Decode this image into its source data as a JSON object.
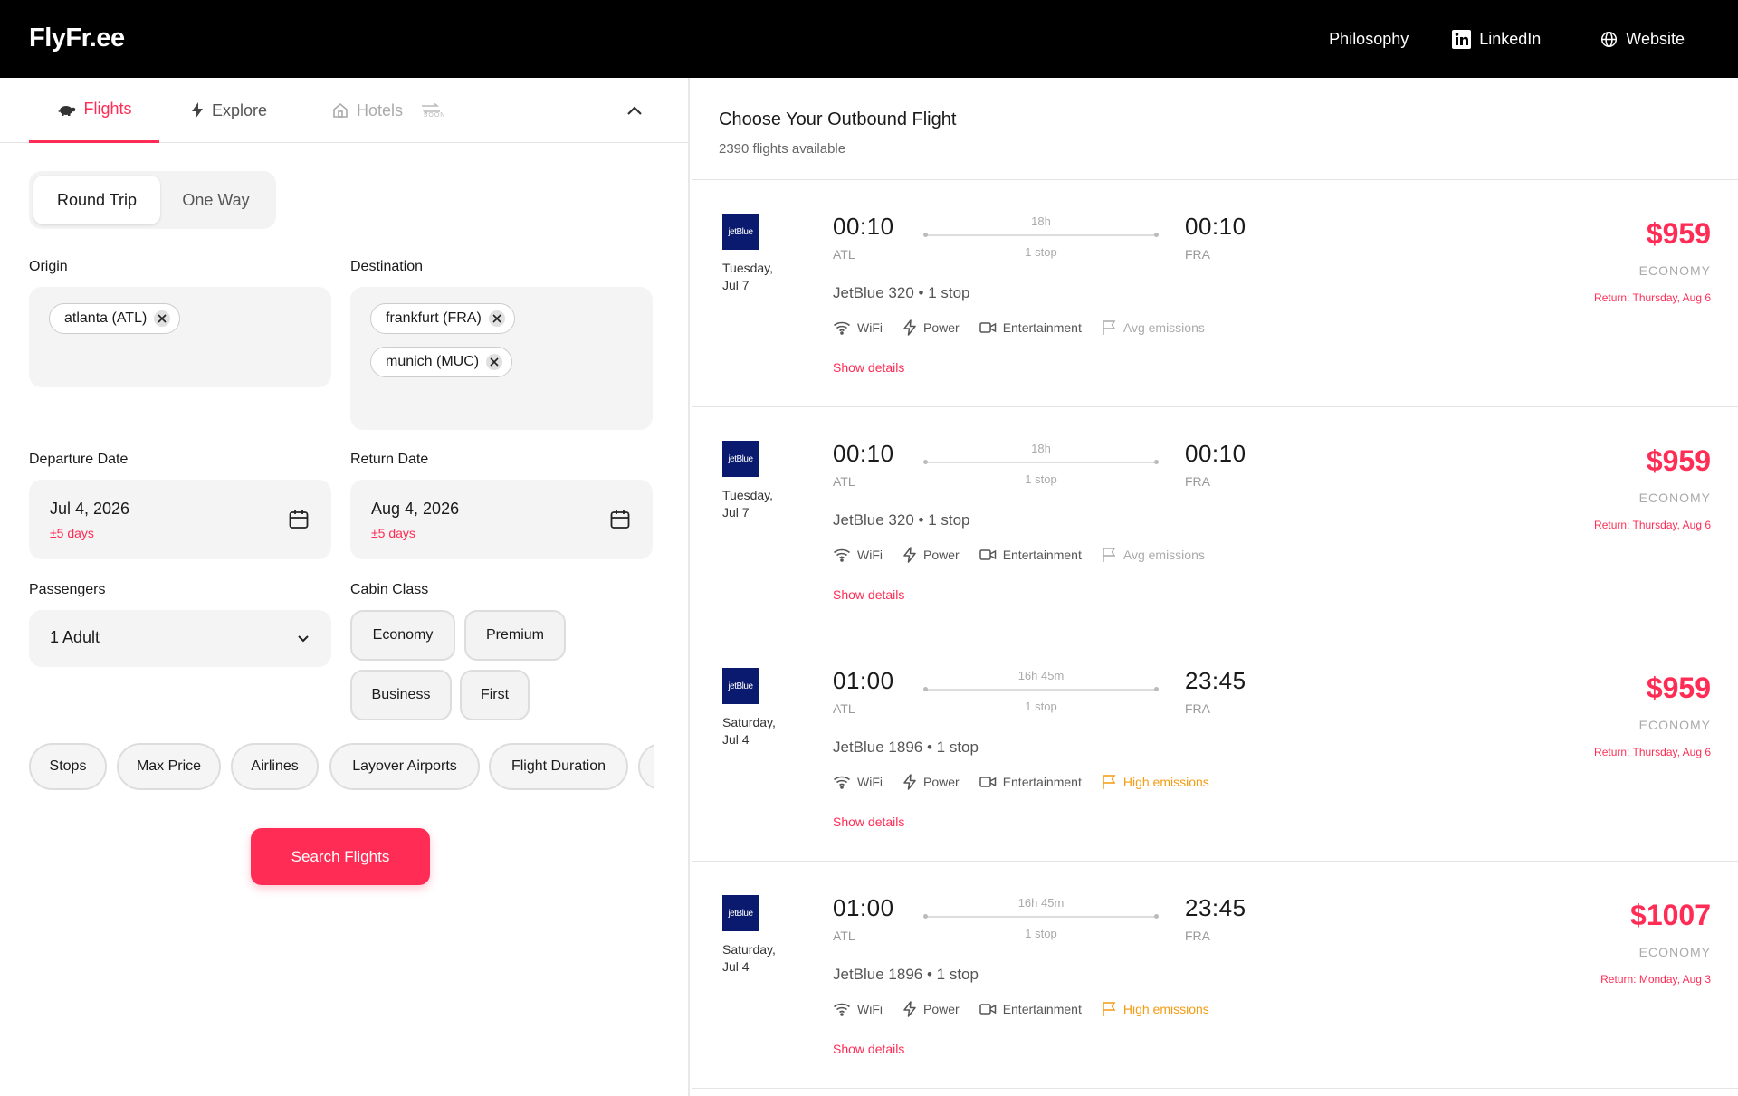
{
  "header": {
    "logo": "FlyFr.ee",
    "nav": {
      "philosophy": "Philosophy",
      "linkedin": "LinkedIn",
      "website": "Website"
    }
  },
  "search": {
    "tabs": {
      "flights": "Flights",
      "explore": "Explore",
      "hotels": "Hotels",
      "soon": "SOON"
    },
    "trip_type": {
      "round_trip": "Round Trip",
      "one_way": "One Way",
      "selected": "Round Trip"
    },
    "origin": {
      "label": "Origin",
      "chips": [
        "atlanta (ATL)"
      ]
    },
    "destination": {
      "label": "Destination",
      "chips": [
        "frankfurt (FRA)",
        "munich (MUC)"
      ]
    },
    "departure": {
      "label": "Departure Date",
      "value": "Jul 4, 2026",
      "flex": "±5 days"
    },
    "return": {
      "label": "Return Date",
      "value": "Aug 4, 2026",
      "flex": "±5 days"
    },
    "passengers": {
      "label": "Passengers",
      "value": "1 Adult"
    },
    "cabin": {
      "label": "Cabin Class",
      "options": [
        "Economy",
        "Premium",
        "Business",
        "First"
      ]
    },
    "filters": [
      "Stops",
      "Max Price",
      "Airlines",
      "Layover Airports",
      "Flight Duration"
    ],
    "search_button": "Search Flights"
  },
  "results": {
    "title": "Choose Your Outbound Flight",
    "count": "2390 flights available",
    "flights": [
      {
        "logo": "jetBlue",
        "date_line1": "Tuesday,",
        "date_line2": "Jul 7",
        "dep_time": "00:10",
        "dep_airport": "ATL",
        "arr_time": "00:10",
        "arr_airport": "FRA",
        "duration": "18h",
        "stops": "1 stop",
        "flight": "JetBlue 320 • 1 stop",
        "wifi": "WiFi",
        "power": "Power",
        "entertainment": "Entertainment",
        "emissions": "Avg emissions",
        "emissions_level": "avg",
        "details": "Show details",
        "price": "$959",
        "cabin": "ECONOMY",
        "return": "Return: Thursday, Aug 6"
      },
      {
        "logo": "jetBlue",
        "date_line1": "Tuesday,",
        "date_line2": "Jul 7",
        "dep_time": "00:10",
        "dep_airport": "ATL",
        "arr_time": "00:10",
        "arr_airport": "FRA",
        "duration": "18h",
        "stops": "1 stop",
        "flight": "JetBlue 320 • 1 stop",
        "wifi": "WiFi",
        "power": "Power",
        "entertainment": "Entertainment",
        "emissions": "Avg emissions",
        "emissions_level": "avg",
        "details": "Show details",
        "price": "$959",
        "cabin": "ECONOMY",
        "return": "Return: Thursday, Aug 6"
      },
      {
        "logo": "jetBlue",
        "date_line1": "Saturday,",
        "date_line2": "Jul 4",
        "dep_time": "01:00",
        "dep_airport": "ATL",
        "arr_time": "23:45",
        "arr_airport": "FRA",
        "duration": "16h 45m",
        "stops": "1 stop",
        "flight": "JetBlue 1896 • 1 stop",
        "wifi": "WiFi",
        "power": "Power",
        "entertainment": "Entertainment",
        "emissions": "High emissions",
        "emissions_level": "high",
        "details": "Show details",
        "price": "$959",
        "cabin": "ECONOMY",
        "return": "Return: Thursday, Aug 6"
      },
      {
        "logo": "jetBlue",
        "date_line1": "Saturday,",
        "date_line2": "Jul 4",
        "dep_time": "01:00",
        "dep_airport": "ATL",
        "arr_time": "23:45",
        "arr_airport": "FRA",
        "duration": "16h 45m",
        "stops": "1 stop",
        "flight": "JetBlue 1896 • 1 stop",
        "wifi": "WiFi",
        "power": "Power",
        "entertainment": "Entertainment",
        "emissions": "High emissions",
        "emissions_level": "high",
        "details": "Show details",
        "price": "$1007",
        "cabin": "ECONOMY",
        "return": "Return: Monday, Aug 3"
      }
    ]
  },
  "colors": {
    "accent": "#ff2d55",
    "header_bg": "#000000",
    "high_emissions": "#f39c12",
    "airline_logo_bg": "#0a1a6e"
  }
}
